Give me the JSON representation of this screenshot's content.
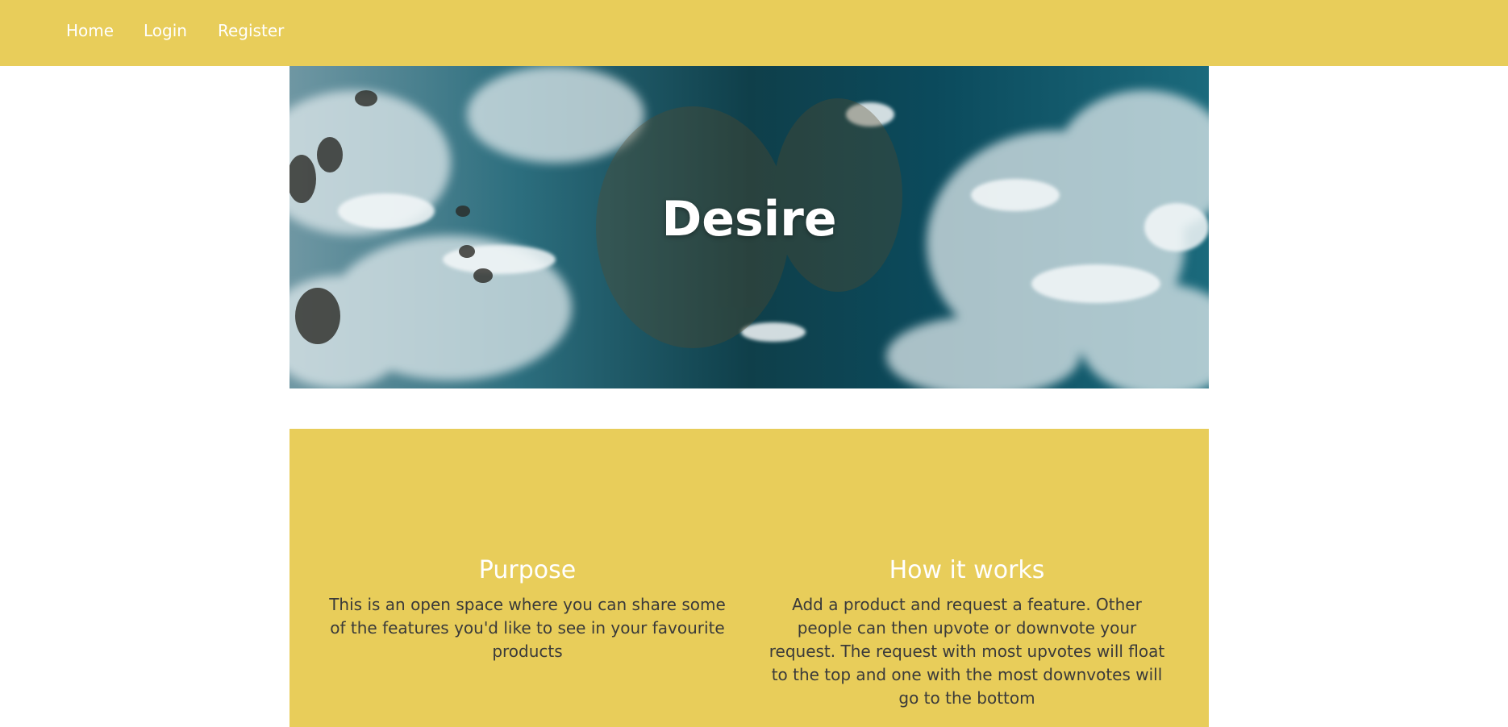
{
  "nav": {
    "home": "Home",
    "login": "Login",
    "register": "Register"
  },
  "hero": {
    "title": "Desire"
  },
  "info": {
    "purpose": {
      "heading": "Purpose",
      "text": "This is an open space where you can share some of the features you'd like to see in your favourite products"
    },
    "how": {
      "heading": "How it works",
      "text": "Add a product and request a feature. Other people can then upvote or downvote your request. The request with most upvotes will float to the top and one with the most downvotes will go to the bottom"
    }
  },
  "colors": {
    "accent": "#e8cd5a",
    "heading_text": "#ffffff",
    "body_text": "#3a3a3a"
  }
}
